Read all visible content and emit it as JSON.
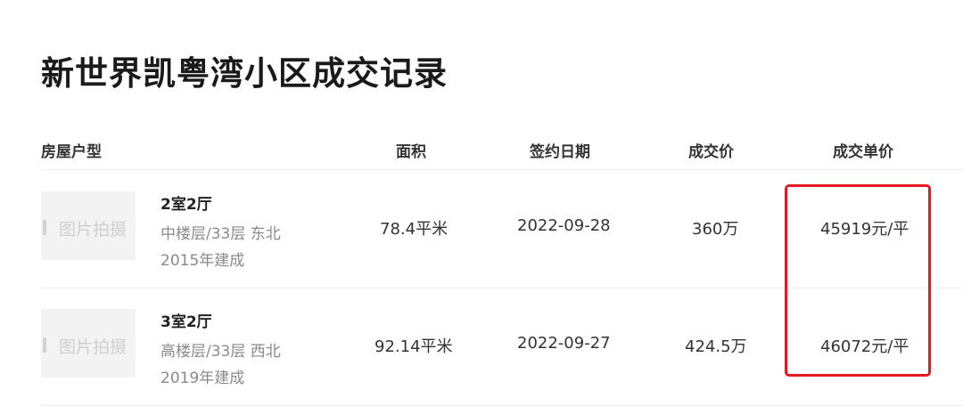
{
  "page": {
    "title": "新世界凯粤湾小区成交记录"
  },
  "table": {
    "headers": {
      "layout": "房屋户型",
      "area": "面积",
      "date": "签约日期",
      "price": "成交价",
      "unit_price": "成交单价"
    },
    "rows": [
      {
        "thumb_text": "图片拍摄",
        "layout": "2室2厅",
        "floor": "中楼层/33层 东北",
        "built": "2015年建成",
        "area": "78.4平米",
        "date": "2022-09-28",
        "price": "360万",
        "unit_price": "45919元/平"
      },
      {
        "thumb_text": "图片拍摄",
        "layout": "3室2厅",
        "floor": "高楼层/33层 西北",
        "built": "2019年建成",
        "area": "92.14平米",
        "date": "2022-09-27",
        "price": "424.5万",
        "unit_price": "46072元/平"
      }
    ]
  },
  "colors": {
    "highlight": "#e6191f",
    "title": "#1a1a1a",
    "secondary_text": "#8a8a8a",
    "thumbnail_bg": "#f3f3f3"
  }
}
